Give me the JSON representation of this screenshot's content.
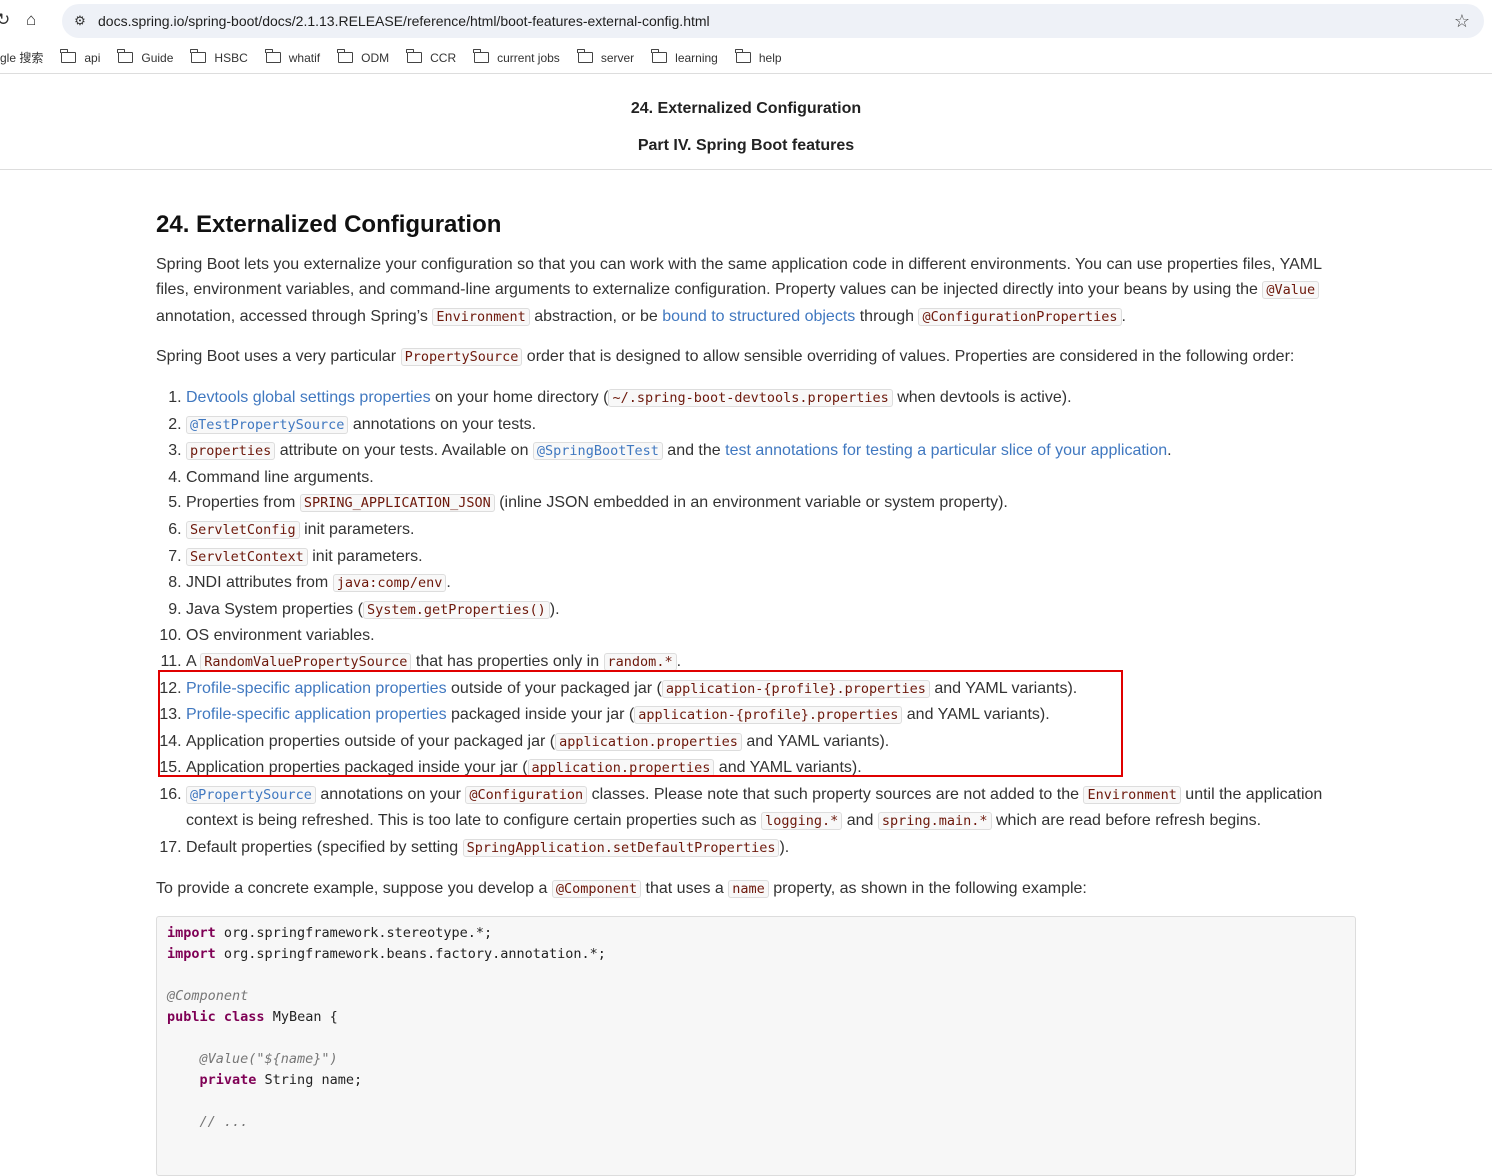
{
  "browser": {
    "url": "docs.spring.io/spring-boot/docs/2.1.13.RELEASE/reference/html/boot-features-external-config.html",
    "bookmarks": [
      "gle 搜索",
      "api",
      "Guide",
      "HSBC",
      "whatif",
      "ODM",
      "CCR",
      "current jobs",
      "server",
      "learning",
      "help"
    ]
  },
  "header": {
    "title": "24. Externalized Configuration",
    "subtitle": "Part IV. Spring Boot features"
  },
  "section_title": "24. Externalized Configuration",
  "intro": [
    {
      "t": "text",
      "v": "Spring Boot lets you externalize your configuration so that you can work with the same application code in different environments. You can use properties files, YAML files, environment variables, and command-line arguments to externalize configuration. Property values can be injected directly into your beans by using the "
    },
    {
      "t": "code",
      "v": "@Value"
    },
    {
      "t": "text",
      "v": " annotation, accessed through Spring’s "
    },
    {
      "t": "code",
      "v": "Environment"
    },
    {
      "t": "text",
      "v": " abstraction, or be "
    },
    {
      "t": "link",
      "v": "bound to structured objects"
    },
    {
      "t": "text",
      "v": " through "
    },
    {
      "t": "code",
      "v": "@ConfigurationProperties"
    },
    {
      "t": "text",
      "v": "."
    }
  ],
  "order_intro": [
    {
      "t": "text",
      "v": "Spring Boot uses a very particular "
    },
    {
      "t": "code",
      "v": "PropertySource"
    },
    {
      "t": "text",
      "v": " order that is designed to allow sensible overriding of values. Properties are considered in the following order:"
    }
  ],
  "order": [
    [
      {
        "t": "link",
        "v": "Devtools global settings properties"
      },
      {
        "t": "text",
        "v": " on your home directory ("
      },
      {
        "t": "code",
        "v": "~/.spring-boot-devtools.properties"
      },
      {
        "t": "text",
        "v": " when devtools is active)."
      }
    ],
    [
      {
        "t": "codelink",
        "v": "@TestPropertySource"
      },
      {
        "t": "text",
        "v": " annotations on your tests."
      }
    ],
    [
      {
        "t": "code",
        "v": "properties"
      },
      {
        "t": "text",
        "v": " attribute on your tests. Available on "
      },
      {
        "t": "codelink",
        "v": "@SpringBootTest"
      },
      {
        "t": "text",
        "v": " and the "
      },
      {
        "t": "link",
        "v": "test annotations for testing a particular slice of your application"
      },
      {
        "t": "text",
        "v": "."
      }
    ],
    [
      {
        "t": "text",
        "v": "Command line arguments."
      }
    ],
    [
      {
        "t": "text",
        "v": "Properties from "
      },
      {
        "t": "code",
        "v": "SPRING_APPLICATION_JSON"
      },
      {
        "t": "text",
        "v": " (inline JSON embedded in an environment variable or system property)."
      }
    ],
    [
      {
        "t": "code",
        "v": "ServletConfig"
      },
      {
        "t": "text",
        "v": " init parameters."
      }
    ],
    [
      {
        "t": "code",
        "v": "ServletContext"
      },
      {
        "t": "text",
        "v": " init parameters."
      }
    ],
    [
      {
        "t": "text",
        "v": "JNDI attributes from "
      },
      {
        "t": "code",
        "v": "java:comp/env"
      },
      {
        "t": "text",
        "v": "."
      }
    ],
    [
      {
        "t": "text",
        "v": "Java System properties ("
      },
      {
        "t": "code",
        "v": "System.getProperties()"
      },
      {
        "t": "text",
        "v": ")."
      }
    ],
    [
      {
        "t": "text",
        "v": "OS environment variables."
      }
    ],
    [
      {
        "t": "text",
        "v": "A "
      },
      {
        "t": "code",
        "v": "RandomValuePropertySource"
      },
      {
        "t": "text",
        "v": " that has properties only in "
      },
      {
        "t": "code",
        "v": "random.*"
      },
      {
        "t": "text",
        "v": "."
      }
    ],
    [
      {
        "t": "link",
        "v": "Profile-specific application properties"
      },
      {
        "t": "text",
        "v": " outside of your packaged jar ("
      },
      {
        "t": "code",
        "v": "application-{profile}.properties"
      },
      {
        "t": "text",
        "v": " and YAML variants)."
      }
    ],
    [
      {
        "t": "link",
        "v": "Profile-specific application properties"
      },
      {
        "t": "text",
        "v": " packaged inside your jar ("
      },
      {
        "t": "code",
        "v": "application-{profile}.properties"
      },
      {
        "t": "text",
        "v": " and YAML variants)."
      }
    ],
    [
      {
        "t": "text",
        "v": "Application properties outside of your packaged jar ("
      },
      {
        "t": "code",
        "v": "application.properties"
      },
      {
        "t": "text",
        "v": " and YAML variants)."
      }
    ],
    [
      {
        "t": "text",
        "v": "Application properties packaged inside your jar ("
      },
      {
        "t": "code",
        "v": "application.properties"
      },
      {
        "t": "text",
        "v": " and YAML variants)."
      }
    ],
    [
      {
        "t": "codelink",
        "v": "@PropertySource"
      },
      {
        "t": "text",
        "v": " annotations on your "
      },
      {
        "t": "code",
        "v": "@Configuration"
      },
      {
        "t": "text",
        "v": " classes. Please note that such property sources are not added to the "
      },
      {
        "t": "code",
        "v": "Environment"
      },
      {
        "t": "text",
        "v": " until the application context is being refreshed. This is too late to configure certain properties such as "
      },
      {
        "t": "code",
        "v": "logging.*"
      },
      {
        "t": "text",
        "v": " and "
      },
      {
        "t": "code",
        "v": "spring.main.*"
      },
      {
        "t": "text",
        "v": " which are read before refresh begins."
      }
    ],
    [
      {
        "t": "text",
        "v": "Default properties (specified by setting "
      },
      {
        "t": "code",
        "v": "SpringApplication.setDefaultProperties"
      },
      {
        "t": "text",
        "v": ")."
      }
    ]
  ],
  "example_intro": [
    {
      "t": "text",
      "v": "To provide a concrete example, suppose you develop a "
    },
    {
      "t": "code",
      "v": "@Component"
    },
    {
      "t": "text",
      "v": " that uses a "
    },
    {
      "t": "code",
      "v": "name"
    },
    {
      "t": "text",
      "v": " property, as shown in the following example:"
    }
  ],
  "code_lines": [
    [
      {
        "c": "kw",
        "v": "import"
      },
      {
        "c": "",
        "v": " org.springframework.stereotype.*;"
      }
    ],
    [
      {
        "c": "kw",
        "v": "import"
      },
      {
        "c": "",
        "v": " org.springframework.beans.factory.annotation.*;"
      }
    ],
    [],
    [
      {
        "c": "an",
        "v": "@Component"
      }
    ],
    [
      {
        "c": "kw",
        "v": "public"
      },
      {
        "c": "",
        "v": " "
      },
      {
        "c": "kw",
        "v": "class"
      },
      {
        "c": "",
        "v": " MyBean {"
      }
    ],
    [],
    [
      {
        "c": "",
        "v": "    "
      },
      {
        "c": "an",
        "v": "@Value(\"${name}\")"
      }
    ],
    [
      {
        "c": "",
        "v": "    "
      },
      {
        "c": "kw",
        "v": "private"
      },
      {
        "c": "",
        "v": " String name;"
      }
    ],
    [],
    [
      {
        "c": "",
        "v": "    "
      },
      {
        "c": "an",
        "v": "// ..."
      }
    ]
  ]
}
